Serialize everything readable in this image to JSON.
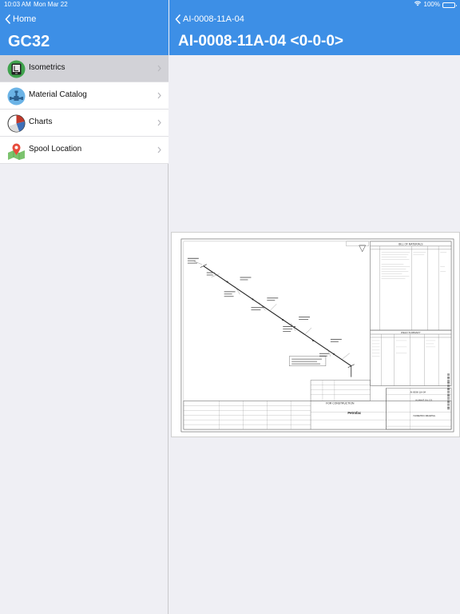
{
  "status_bar": {
    "time": "10:03 AM",
    "date": "Mon Mar 22",
    "battery": "100%"
  },
  "master": {
    "back_label": "Home",
    "title": "GC32",
    "items": [
      {
        "label": "Isometrics",
        "icon": "isometrics-icon",
        "selected": true
      },
      {
        "label": "Material Catalog",
        "icon": "material-catalog-icon",
        "selected": false
      },
      {
        "label": "Charts",
        "icon": "pie-chart-icon",
        "selected": false
      },
      {
        "label": "Spool Location",
        "icon": "map-pin-icon",
        "selected": false
      }
    ]
  },
  "detail": {
    "back_label": "AI-0008-11A-04",
    "title": "AI-0008-11A-04 <0-0-0>",
    "drawing": {
      "bom_title": "BILL OF MATERIALS",
      "construction_stamp": "FOR CONSTRUCTION",
      "company": "Petrofac",
      "owner": "KUWAIT OIL CO.",
      "line_no": "AI-0008-11A-04",
      "drawing_type": "ISOMETRIC DRAWING",
      "weld_summary": "WELD SUMMARY"
    }
  },
  "colors": {
    "nav_blue": "#3d8fe6",
    "selected_row": "#d2d2d7",
    "background": "#efeff4"
  }
}
